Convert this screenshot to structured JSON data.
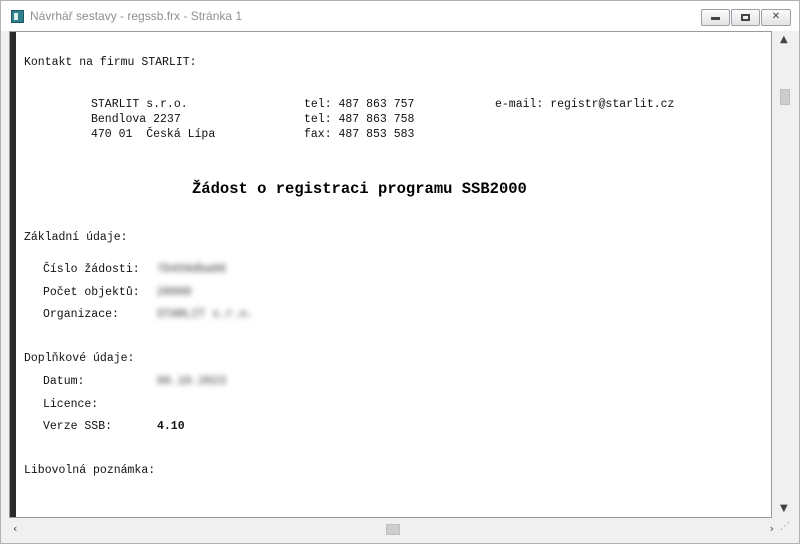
{
  "window": {
    "title": "Návrhář sestavy - regssb.frx - Stránka 1",
    "buttons": {
      "minimize": "—",
      "maximize": "□",
      "close": "✕"
    }
  },
  "report": {
    "contact_heading": "Kontakt na firmu STARLIT:",
    "company": {
      "name": "STARLIT s.r.o.",
      "street": "Bendlova 2237",
      "city": "470 01  Česká Lípa",
      "tel1": "tel: 487 863 757",
      "tel2": "tel: 487 863 758",
      "fax": "fax: 487 853 583",
      "email": "e-mail: registr@starlit.cz"
    },
    "title": "Žádost o registraci programu SSB2000",
    "basic": {
      "heading": "Základní údaje:",
      "fields": [
        {
          "label": "Číslo žádosti:",
          "value": "7D459dba00"
        },
        {
          "label": "Počet objektů:",
          "value": "20000"
        },
        {
          "label": "Organizace:",
          "value": "STARLIT s.r.o."
        }
      ]
    },
    "extra": {
      "heading": "Doplňkové údaje:",
      "fields": [
        {
          "label": "Datum:",
          "value": "09.10.2023"
        },
        {
          "label": "Licence:",
          "value": ""
        },
        {
          "label": "Verze SSB:",
          "value": "4.10"
        }
      ]
    },
    "note_heading": "Libovolná poznámka:"
  }
}
